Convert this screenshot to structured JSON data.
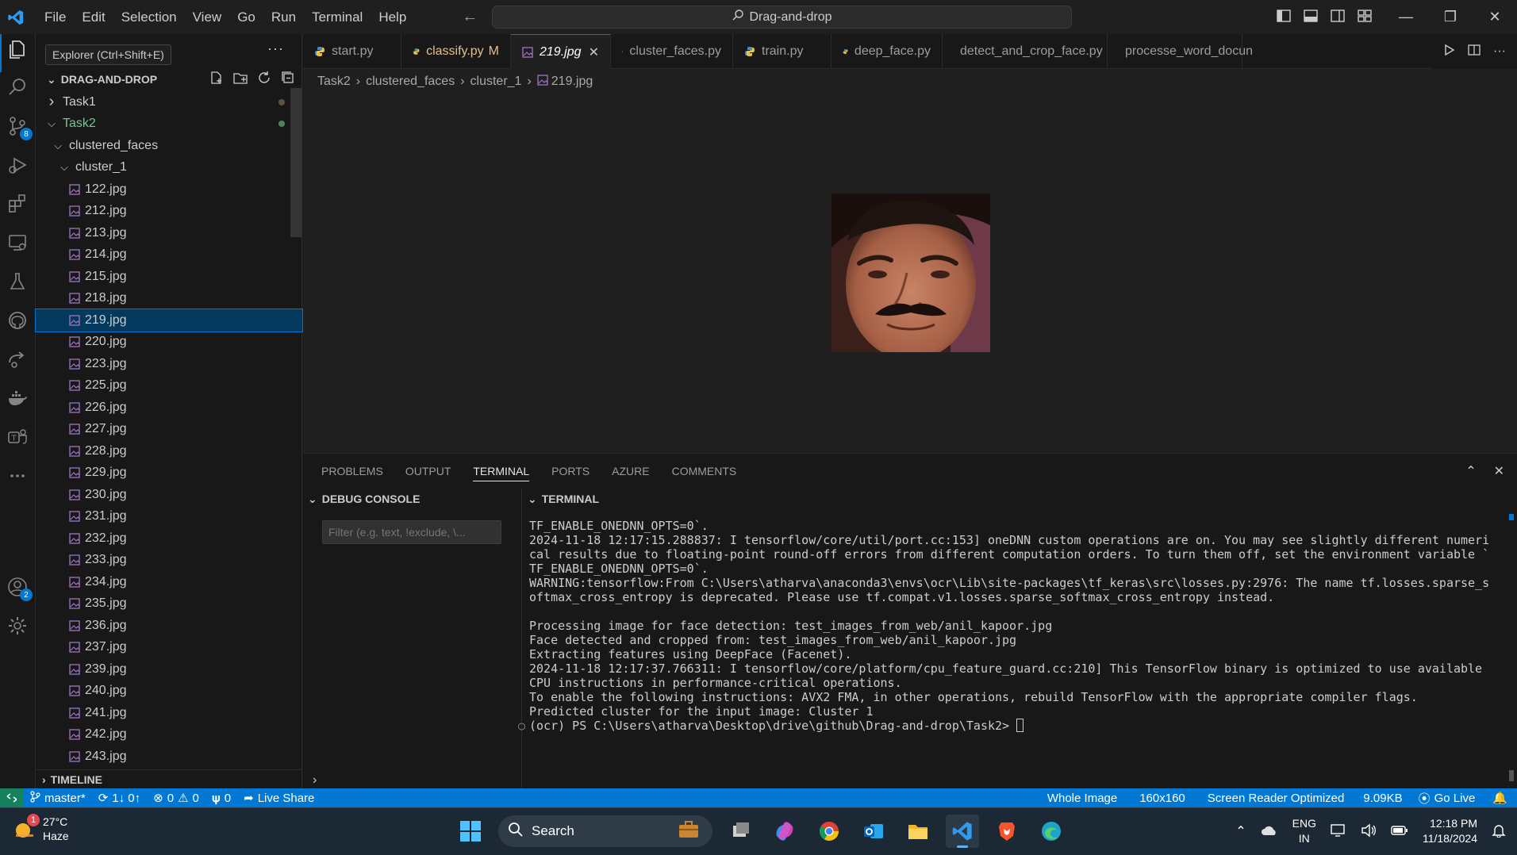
{
  "titlebar": {
    "menu": [
      "File",
      "Edit",
      "Selection",
      "View",
      "Go",
      "Run",
      "Terminal",
      "Help"
    ],
    "search_text": "Drag-and-drop"
  },
  "activitybar": {
    "scm_badge": "8",
    "accounts_badge": "2"
  },
  "sidebar": {
    "tooltip": "Explorer (Ctrl+Shift+E)",
    "workspace": "DRAG-AND-DROP",
    "tree": [
      {
        "label": "Task1",
        "depth": 1,
        "type": "folder",
        "expanded": false,
        "dot": "brown"
      },
      {
        "label": "Task2",
        "depth": 1,
        "type": "folder",
        "expanded": true,
        "dot": "green",
        "color": "#73c991"
      },
      {
        "label": "clustered_faces",
        "depth": 2,
        "type": "folder",
        "expanded": true
      },
      {
        "label": "cluster_1",
        "depth": 3,
        "type": "folder",
        "expanded": true
      },
      {
        "label": "122.jpg",
        "depth": 4,
        "type": "image"
      },
      {
        "label": "212.jpg",
        "depth": 4,
        "type": "image"
      },
      {
        "label": "213.jpg",
        "depth": 4,
        "type": "image"
      },
      {
        "label": "214.jpg",
        "depth": 4,
        "type": "image"
      },
      {
        "label": "215.jpg",
        "depth": 4,
        "type": "image"
      },
      {
        "label": "218.jpg",
        "depth": 4,
        "type": "image"
      },
      {
        "label": "219.jpg",
        "depth": 4,
        "type": "image",
        "selected": true
      },
      {
        "label": "220.jpg",
        "depth": 4,
        "type": "image"
      },
      {
        "label": "223.jpg",
        "depth": 4,
        "type": "image"
      },
      {
        "label": "225.jpg",
        "depth": 4,
        "type": "image"
      },
      {
        "label": "226.jpg",
        "depth": 4,
        "type": "image"
      },
      {
        "label": "227.jpg",
        "depth": 4,
        "type": "image"
      },
      {
        "label": "228.jpg",
        "depth": 4,
        "type": "image"
      },
      {
        "label": "229.jpg",
        "depth": 4,
        "type": "image"
      },
      {
        "label": "230.jpg",
        "depth": 4,
        "type": "image"
      },
      {
        "label": "231.jpg",
        "depth": 4,
        "type": "image"
      },
      {
        "label": "232.jpg",
        "depth": 4,
        "type": "image"
      },
      {
        "label": "233.jpg",
        "depth": 4,
        "type": "image"
      },
      {
        "label": "234.jpg",
        "depth": 4,
        "type": "image"
      },
      {
        "label": "235.jpg",
        "depth": 4,
        "type": "image"
      },
      {
        "label": "236.jpg",
        "depth": 4,
        "type": "image"
      },
      {
        "label": "237.jpg",
        "depth": 4,
        "type": "image"
      },
      {
        "label": "239.jpg",
        "depth": 4,
        "type": "image"
      },
      {
        "label": "240.jpg",
        "depth": 4,
        "type": "image"
      },
      {
        "label": "241.jpg",
        "depth": 4,
        "type": "image"
      },
      {
        "label": "242.jpg",
        "depth": 4,
        "type": "image"
      },
      {
        "label": "243.jpg",
        "depth": 4,
        "type": "image"
      }
    ],
    "timeline": "TIMELINE"
  },
  "tabs": [
    {
      "label": "start.py",
      "icon": "python-icon"
    },
    {
      "label": "classify.py",
      "suffix": "M",
      "icon": "python-icon",
      "modified": true
    },
    {
      "label": "219.jpg",
      "icon": "image-icon",
      "active": true
    },
    {
      "label": "cluster_faces.py",
      "icon": "python-icon"
    },
    {
      "label": "train.py",
      "icon": "python-icon"
    },
    {
      "label": "deep_face.py",
      "icon": "python-icon"
    },
    {
      "label": "detect_and_crop_face.py",
      "icon": "python-icon"
    },
    {
      "label": "processe_word_docun",
      "icon": "python-icon"
    }
  ],
  "breadcrumbs": [
    "Task2",
    "clustered_faces",
    "cluster_1",
    "219.jpg"
  ],
  "panel": {
    "tabs": [
      "PROBLEMS",
      "OUTPUT",
      "TERMINAL",
      "PORTS",
      "AZURE",
      "COMMENTS"
    ],
    "active_tab": "TERMINAL",
    "debug_console_title": "DEBUG CONSOLE",
    "filter_placeholder": "Filter (e.g. text, !exclude, \\...",
    "terminal_title": "TERMINAL",
    "terminal_lines": [
      "TF_ENABLE_ONEDNN_OPTS=0`.",
      "2024-11-18 12:17:15.288837: I tensorflow/core/util/port.cc:153] oneDNN custom operations are on. You may see slightly different numeri",
      "cal results due to floating-point round-off errors from different computation orders. To turn them off, set the environment variable `",
      "TF_ENABLE_ONEDNN_OPTS=0`.",
      "WARNING:tensorflow:From C:\\Users\\atharva\\anaconda3\\envs\\ocr\\Lib\\site-packages\\tf_keras\\src\\losses.py:2976: The name tf.losses.sparse_s",
      "oftmax_cross_entropy is deprecated. Please use tf.compat.v1.losses.sparse_softmax_cross_entropy instead.",
      "",
      "Processing image for face detection: test_images_from_web/anil_kapoor.jpg",
      "Face detected and cropped from: test_images_from_web/anil_kapoor.jpg",
      "Extracting features using DeepFace (Facenet).",
      "2024-11-18 12:17:37.766311: I tensorflow/core/platform/cpu_feature_guard.cc:210] This TensorFlow binary is optimized to use available",
      "CPU instructions in performance-critical operations.",
      "To enable the following instructions: AVX2 FMA, in other operations, rebuild TensorFlow with the appropriate compiler flags.",
      "Predicted cluster for the input image: Cluster 1"
    ],
    "prompt": "(ocr) PS C:\\Users\\atharva\\Desktop\\drive\\github\\Drag-and-drop\\Task2> "
  },
  "statusbar": {
    "branch": "master*",
    "sync": "1↓ 0↑",
    "errors": "0",
    "warnings": "0",
    "ports": "0",
    "live_share": "Live Share",
    "whole_image": "Whole Image",
    "dimensions": "160x160",
    "screen_reader": "Screen Reader Optimized",
    "file_size": "9.09KB",
    "go_live": "Go Live"
  },
  "taskbar": {
    "weather_badge": "1",
    "temperature": "27°C",
    "condition": "Haze",
    "search_label": "Search",
    "lang_top": "ENG",
    "lang_bottom": "IN",
    "time": "12:18 PM",
    "date": "11/18/2024"
  },
  "colors": {
    "accent": "#0078d4",
    "statusbar": "#0078d4",
    "selection": "#04395e",
    "modified": "#e2c08d",
    "git_added": "#73c991"
  }
}
